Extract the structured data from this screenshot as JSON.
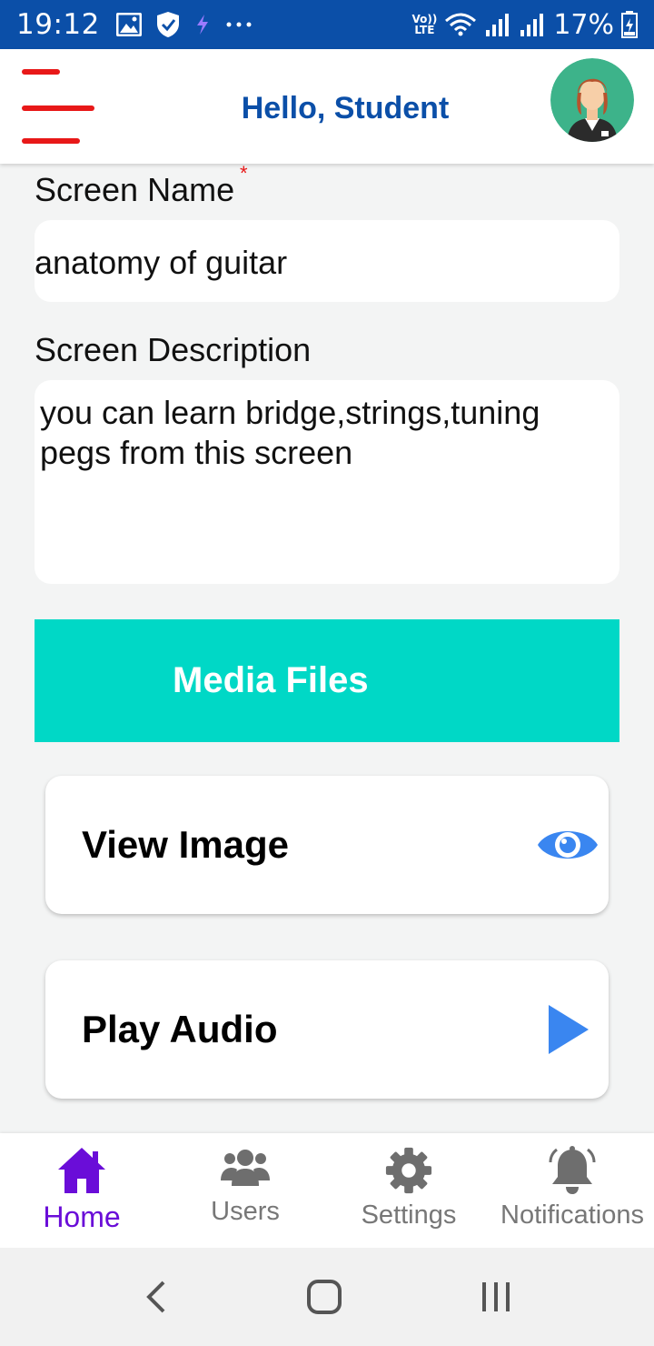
{
  "status_bar": {
    "time": "19:12",
    "battery": "17%",
    "lte_line1": "Vo))",
    "lte_line2": "LTE"
  },
  "header": {
    "title": "Hello, Student",
    "menu_icon": "hamburger-icon",
    "avatar_icon": "avatar-icon"
  },
  "form": {
    "screen_name_label": "Screen Name",
    "screen_name_value": "anatomy of guitar",
    "required_mark": "*",
    "screen_description_label": "Screen Description",
    "screen_description_value": "you can learn bridge,strings,tuning pegs from this screen"
  },
  "media": {
    "banner_title": "Media Files",
    "view_image_label": "View Image",
    "view_image_icon": "eye-icon",
    "play_audio_label": "Play Audio",
    "play_audio_icon": "play-icon"
  },
  "bottom_nav": {
    "items": [
      {
        "label": "Home",
        "icon": "home-icon",
        "active": true
      },
      {
        "label": "Users",
        "icon": "users-icon",
        "active": false
      },
      {
        "label": "Settings",
        "icon": "gear-icon",
        "active": false
      },
      {
        "label": "Notifications",
        "icon": "bell-icon",
        "active": false
      }
    ]
  },
  "colors": {
    "brand_blue": "#0b4fa8",
    "menu_red": "#e81818",
    "teal": "#00d8c6",
    "accent_blue": "#3a86f0",
    "active_purple": "#6a0dd8"
  }
}
